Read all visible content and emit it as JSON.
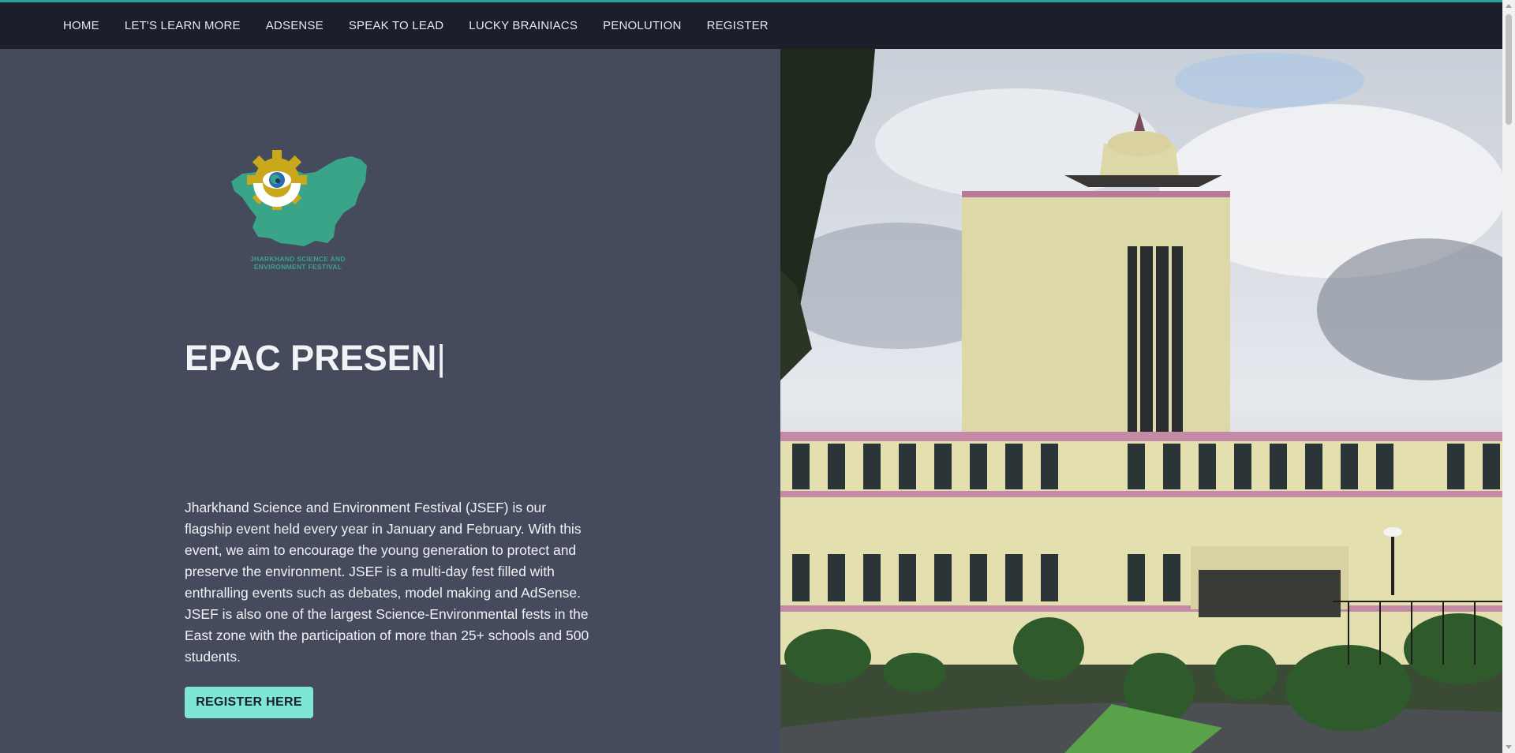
{
  "nav": {
    "items": [
      {
        "label": "HOME"
      },
      {
        "label": "LET'S LEARN MORE"
      },
      {
        "label": "ADSENSE"
      },
      {
        "label": "SPEAK TO LEAD"
      },
      {
        "label": "LUCKY BRAINIACS"
      },
      {
        "label": "PENOLUTION"
      },
      {
        "label": "REGISTER"
      }
    ]
  },
  "hero": {
    "logo_caption_line1": "JHARKHAND SCIENCE AND",
    "logo_caption_line2": "ENVIRONMENT FESTIVAL",
    "title": "EPAC PRESEN",
    "cursor": "|",
    "description": "Jharkhand Science and Environment Festival (JSEF) is our flagship event held every year in January and February. With this event, we aim to encourage the young generation to protect and preserve the environment. JSEF is a multi-day fest filled with enthralling events such as debates, model making and AdSense. JSEF is also one of the largest Science-Environmental fests in the East zone with the participation of more than 25+ schools and 500 students.",
    "register_button": "REGISTER HERE"
  },
  "colors": {
    "navbar": "#1b1f2a",
    "left_panel": "#454a5c",
    "button": "#7ee6d6",
    "logo_map": "#3aa488",
    "logo_gear": "#c9a81c"
  }
}
